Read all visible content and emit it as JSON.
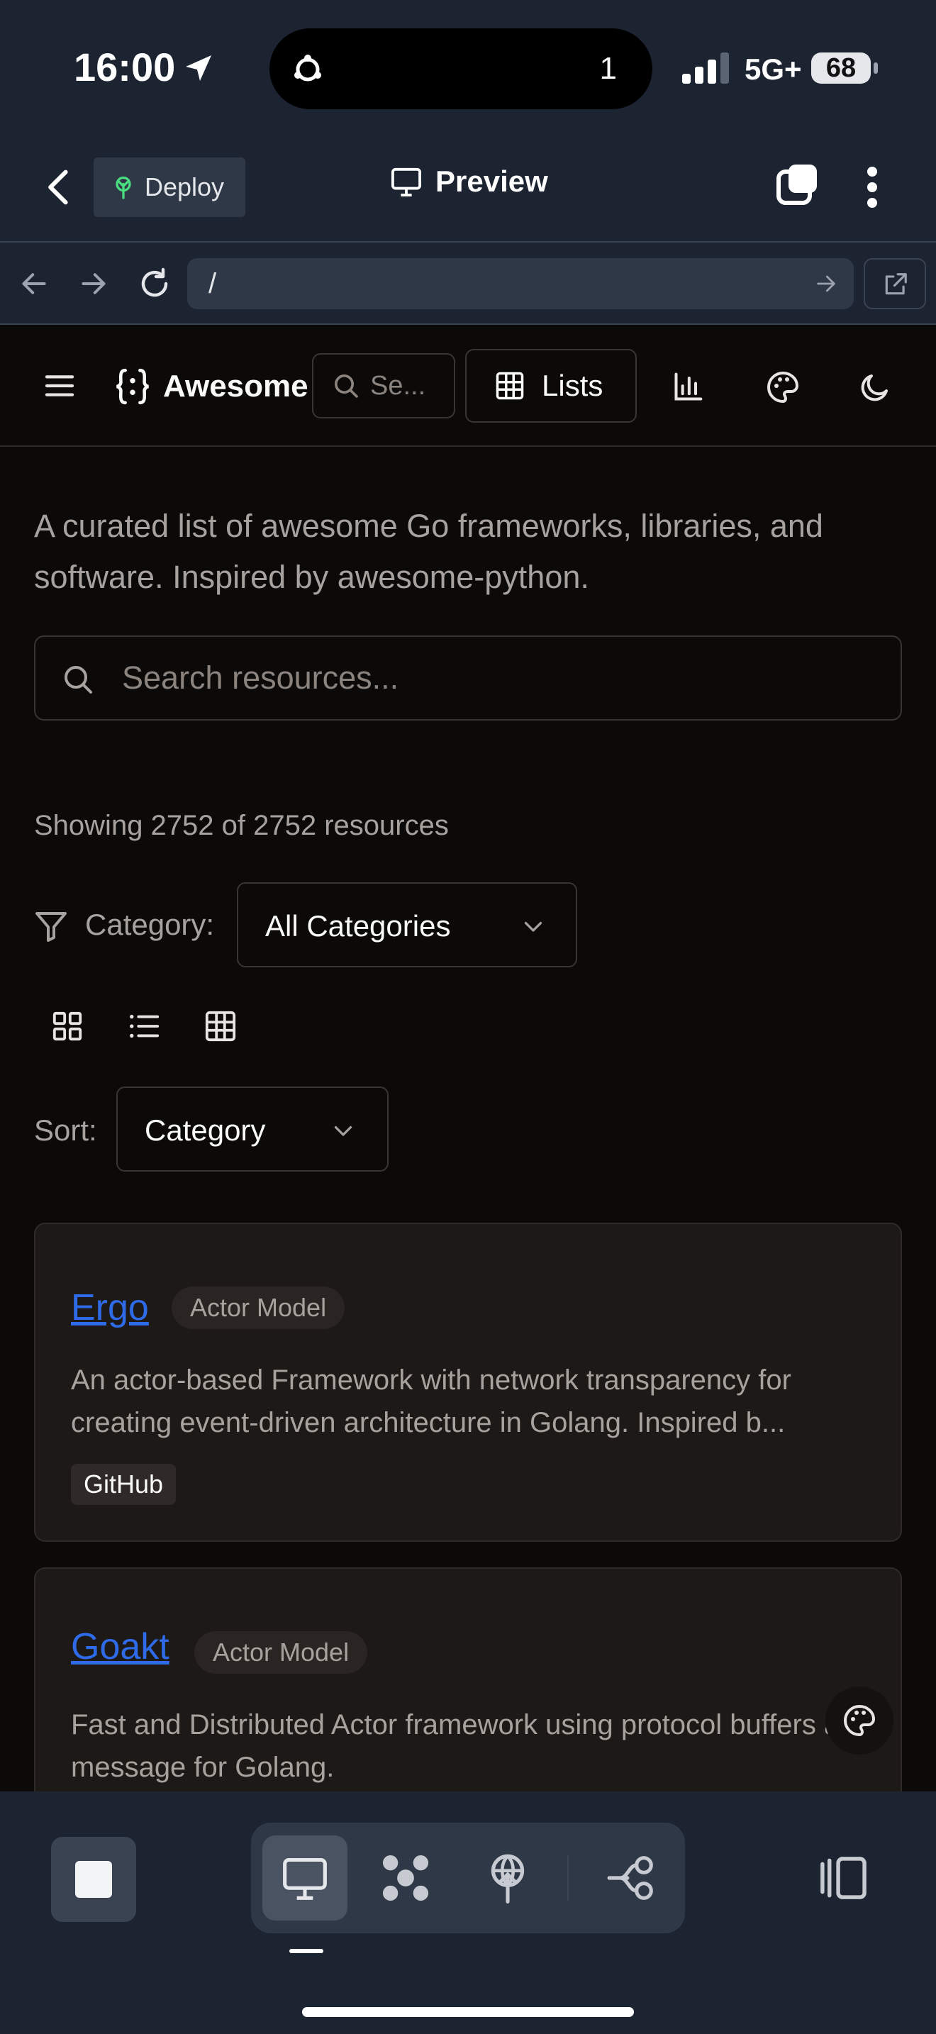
{
  "status_bar": {
    "time": "16:00",
    "island_count": "1",
    "network": "5G+",
    "battery": "68"
  },
  "replit_header": {
    "deploy_label": "Deploy",
    "preview_label": "Preview"
  },
  "url_bar": {
    "path": "/"
  },
  "app_nav": {
    "brand": "Awesome",
    "search_placeholder": "Se...",
    "lists_label": "Lists"
  },
  "intro": "A curated list of awesome Go frameworks, libraries, and software. Inspired by awesome-python.",
  "search": {
    "placeholder": "Search resources..."
  },
  "results": {
    "showing": "Showing 2752 of 2752 resources"
  },
  "filters": {
    "category_label": "Category:",
    "category_value": "All Categories",
    "sort_label": "Sort:",
    "sort_value": "Category"
  },
  "resources": [
    {
      "title": "Ergo",
      "category": "Actor Model",
      "description": "An actor-based Framework with network transparency for creating event-driven architecture in Golang. Inspired b...",
      "tag": "GitHub"
    },
    {
      "title": "Goakt",
      "category": "Actor Model",
      "description": "Fast and Distributed Actor framework using protocol buffers as message for Golang."
    }
  ],
  "colors": {
    "link": "#2f6be8",
    "background": "#0c0a09",
    "card": "#1c1917",
    "ide_chrome": "#1c2331"
  },
  "icons": [
    "back-arrow-icon",
    "deploy-icon",
    "monitor-icon",
    "tabs-icon",
    "more-vertical-icon",
    "refresh-icon",
    "external-link-icon",
    "menu-icon",
    "braces-icon",
    "search-icon",
    "table-icon",
    "bar-chart-icon",
    "palette-icon",
    "moon-icon",
    "filter-icon",
    "chevron-down-icon",
    "grid-view-icon",
    "list-view-icon",
    "table-view-icon",
    "stop-icon",
    "workflows-icon",
    "git-icon",
    "panel-icon"
  ]
}
